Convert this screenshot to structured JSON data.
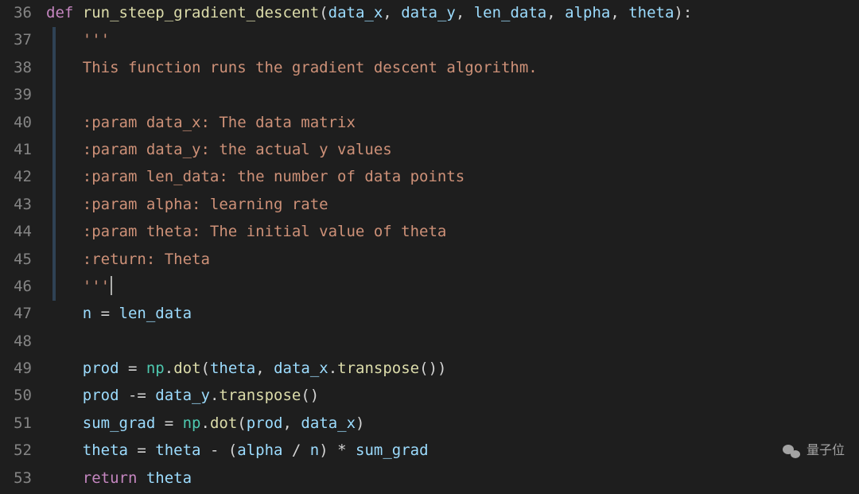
{
  "gutter": {
    "start": 36,
    "end": 53
  },
  "code": {
    "def": "def",
    "fn_name": "run_steep_gradient_descent",
    "params": [
      "data_x",
      "data_y",
      "len_data",
      "alpha",
      "theta"
    ],
    "docstring": {
      "open": "'''",
      "l1": "This function runs the gradient descent algorithm.",
      "blank": "",
      "p1": ":param data_x: The data matrix",
      "p2": ":param data_y: the actual y values",
      "p3": ":param len_data: the number of data points",
      "p4": ":param alpha: learning rate",
      "p5": ":param theta: The initial value of theta",
      "ret": ":return: Theta",
      "close": "'''"
    },
    "body": {
      "n_assign": {
        "lhs": "n",
        "eq": " = ",
        "rhs": "len_data"
      },
      "prod1": {
        "lhs": "prod",
        "eq": " = ",
        "np": "np",
        "dot": "dot",
        "a1": "theta",
        "a2": "data_x",
        "tr": "transpose"
      },
      "prod2": {
        "lhs": "prod",
        "op": " -= ",
        "a": "data_y",
        "tr": "transpose"
      },
      "sumg": {
        "lhs": "sum_grad",
        "eq": " = ",
        "np": "np",
        "dot": "dot",
        "a1": "prod",
        "a2": "data_x"
      },
      "theta": {
        "lhs": "theta",
        "eq": " = ",
        "rhs1": "theta",
        "minus": " - (",
        "alpha": "alpha",
        "div": " / ",
        "n": "n",
        "close": ") * ",
        "sg": "sum_grad"
      },
      "return": {
        "kw": "return",
        "val": "theta"
      }
    }
  },
  "watermark": "量子位"
}
